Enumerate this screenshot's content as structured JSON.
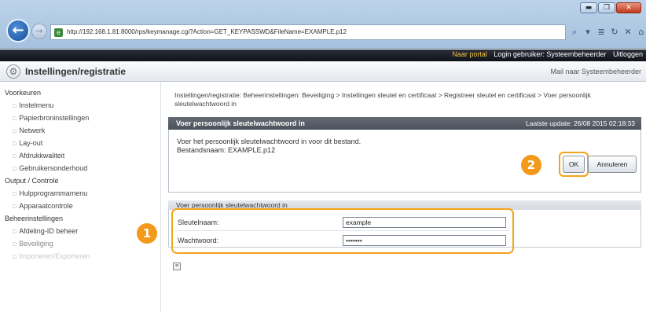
{
  "browser": {
    "window_controls": [
      "▬",
      "❐",
      "✕"
    ],
    "address": "http://192.168.1.81:8000/rps/keymanage.cgi?Action=GET_KEYPASSWD&FileName=EXAMPLE.p12",
    "address_tools": [
      "⌕",
      "▾",
      "≣",
      "↻",
      "✕",
      "⌂",
      "☆",
      "⚙"
    ]
  },
  "topbar": {
    "portal": "Naar portal",
    "login": "Login gebruiker: Systeembeheerder",
    "logout": "Uitloggen"
  },
  "header": {
    "title": "Instellingen/registratie",
    "mail_link": "Mail naar Systeembeheerder"
  },
  "sidebar": {
    "groups": [
      {
        "label": "Voorkeuren",
        "items": [
          "Instelmenu",
          "Papierbroninstellingen",
          "Netwerk",
          "Lay-out",
          "Afdrukkwaliteit",
          "Gebruikersonderhoud"
        ]
      },
      {
        "label": "Output / Controle",
        "items": [
          "Hulpprogrammamenu",
          "Apparaatcontrole"
        ]
      },
      {
        "label": "Beheerinstellingen",
        "items": [
          "Afdeling-ID beheer",
          "Beveiliging",
          "Importeren/Exporteren"
        ]
      }
    ]
  },
  "breadcrumb": "Instellingen/registratie: Beheerinstellingen: Beveiliging > Instellingen sleutel en certificaat > Registreer sleutel en certificaat > Voer persoonlijk sleutelwachtwoord in",
  "panel": {
    "title": "Voer persoonlijk sleutelwachtwoord in",
    "update": "Laatste update: 26/08 2015 02:18:33",
    "instruction": "Voer het persoonlijk sleutelwachtwoord in voor dit bestand.",
    "filename_label": "Bestandsnaam: EXAMPLE.p12",
    "ok_label": "OK",
    "cancel_label": "Annuleren"
  },
  "form": {
    "title": "Voer persoonlijk sleutelwachtwoord in",
    "key_label": "Sleutelnaam:",
    "key_value": "example",
    "password_label": "Wachtwoord:",
    "password_value": "•••••••"
  },
  "callouts": {
    "one": "1",
    "two": "2"
  },
  "colors": {
    "accent": "#f4a31c",
    "panel_header": "#575d66"
  }
}
